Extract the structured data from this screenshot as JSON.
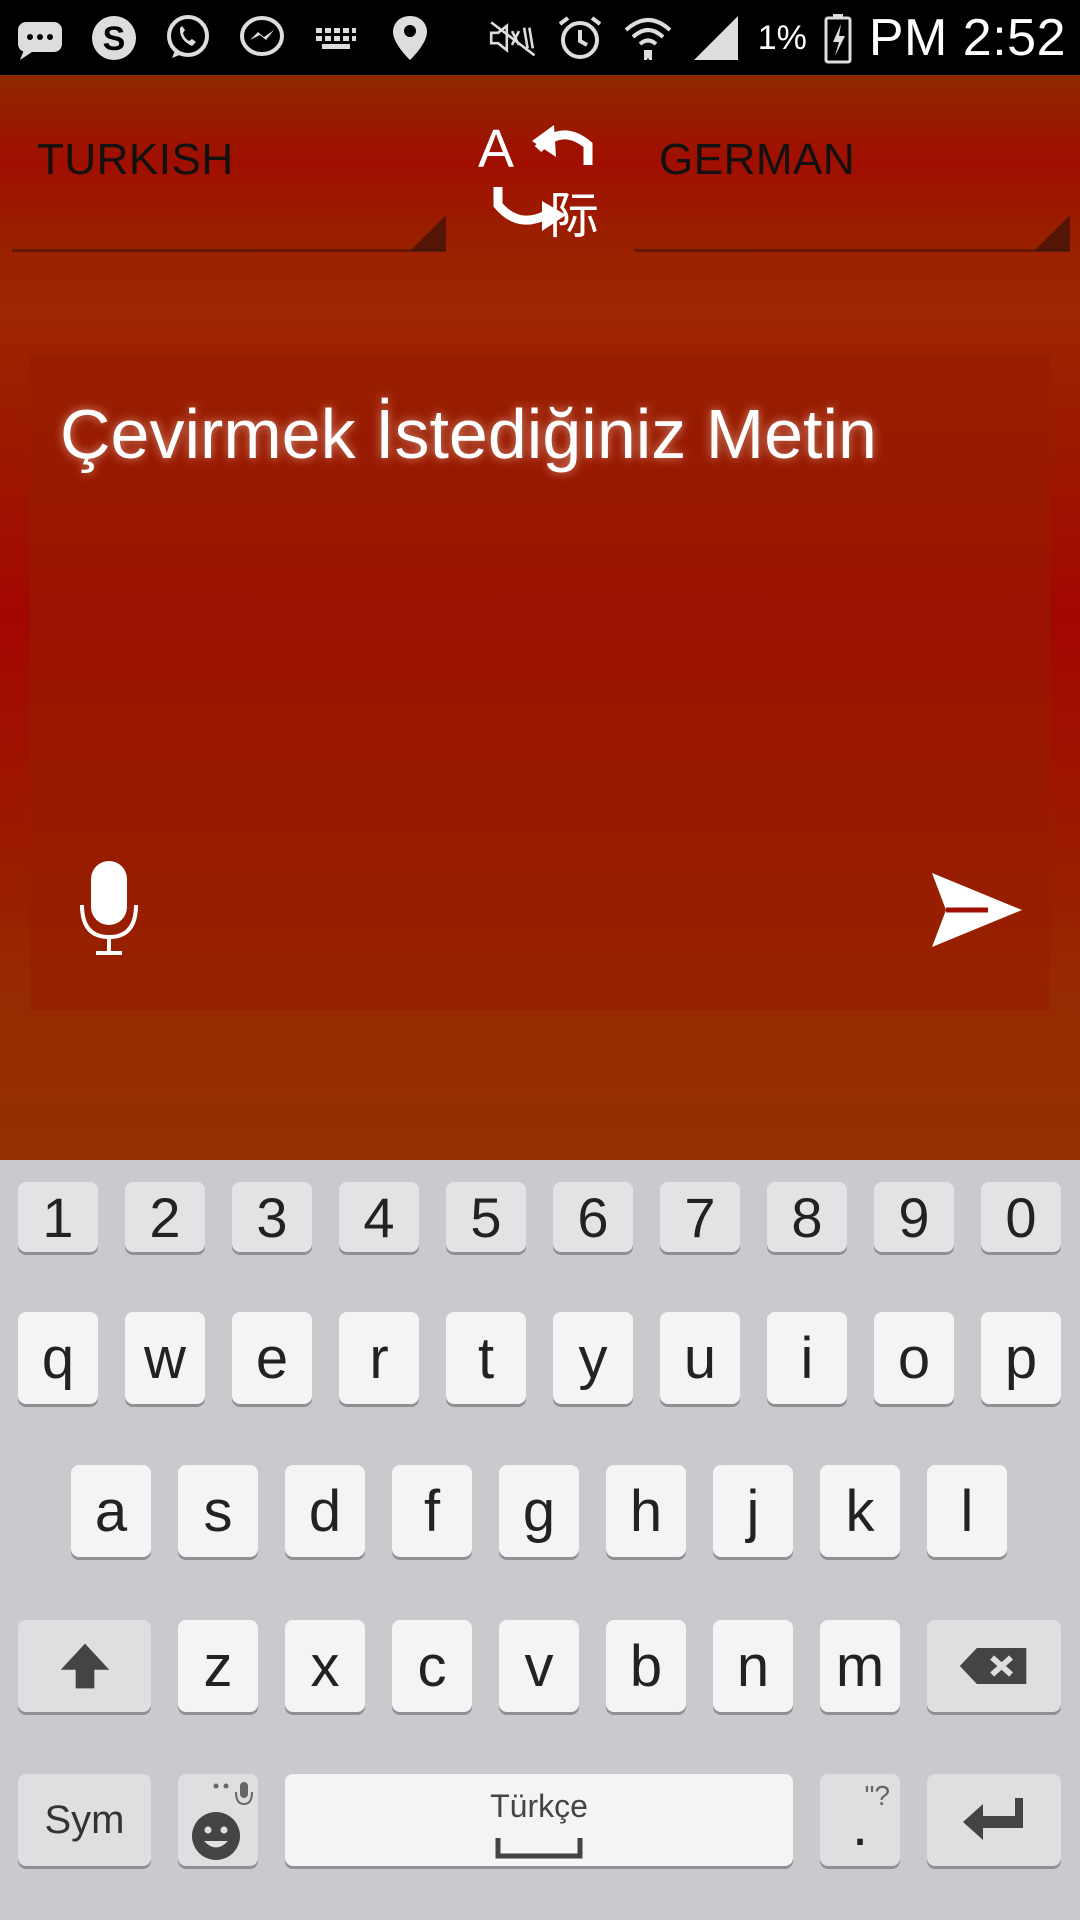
{
  "status_bar": {
    "left_icons": [
      "chat-icon",
      "skype-icon",
      "whatsapp-icon",
      "messenger-icon",
      "keyboard-icon",
      "location-icon"
    ],
    "right_icons": [
      "mute-icon",
      "alarm-icon",
      "wifi-icon",
      "signal-icon",
      "battery-icon"
    ],
    "battery_percent": "1%",
    "time": "PM 2:52"
  },
  "language_bar": {
    "source_language": "TURKISH",
    "target_language": "GERMAN"
  },
  "input": {
    "placeholder": "Çevirmek İstediğiniz Metin"
  },
  "keyboard": {
    "number_row": [
      "1",
      "2",
      "3",
      "4",
      "5",
      "6",
      "7",
      "8",
      "9",
      "0"
    ],
    "row1": [
      "q",
      "w",
      "e",
      "r",
      "t",
      "y",
      "u",
      "i",
      "o",
      "p"
    ],
    "row2": [
      "a",
      "s",
      "d",
      "f",
      "g",
      "h",
      "j",
      "k",
      "l"
    ],
    "row3": [
      "z",
      "x",
      "c",
      "v",
      "b",
      "n",
      "m"
    ],
    "sym_label": "Sym",
    "space_label": "Türkçe",
    "period_label": ".",
    "period_hint": "\"?",
    "colors": {
      "background": "#c9cacd",
      "key": "#f4f4f4"
    }
  },
  "colors": {
    "app_red": "#a30600",
    "app_orange": "#943000",
    "text_dark": "#111111"
  }
}
